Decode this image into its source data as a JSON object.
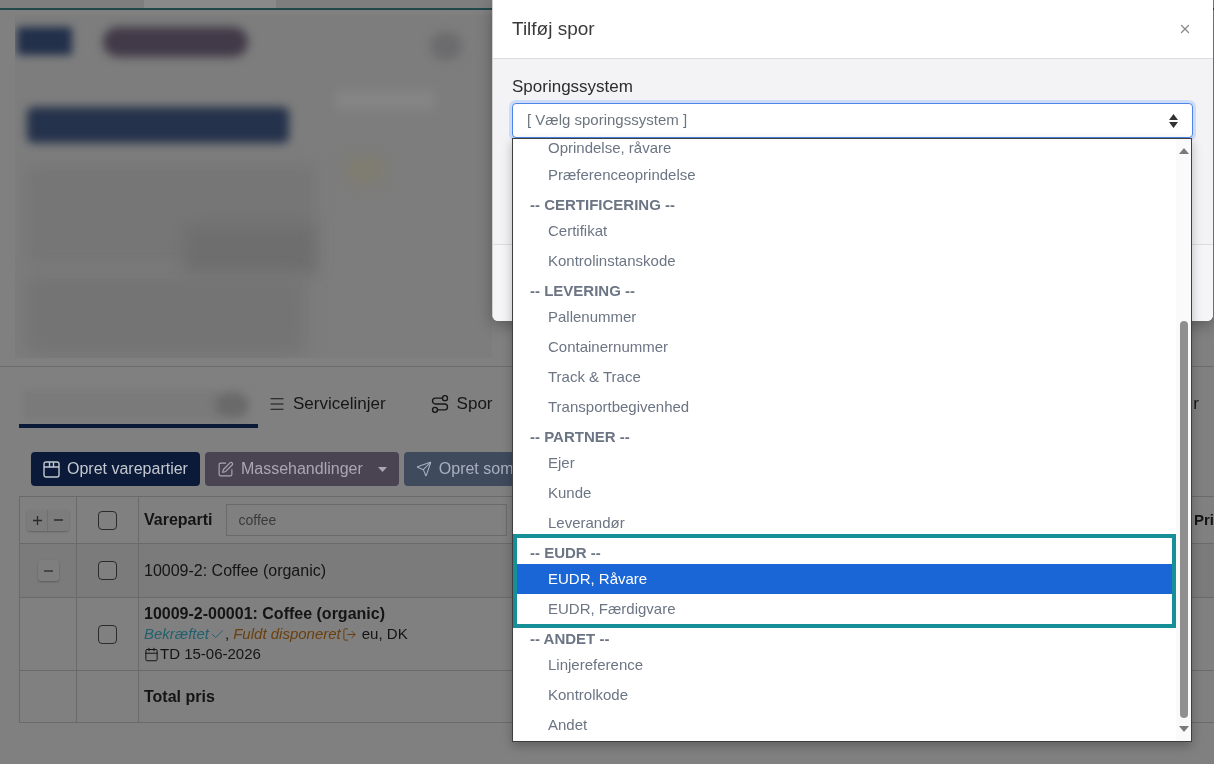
{
  "background": {
    "tabs": [
      {
        "kind": "blurred",
        "selected": true
      },
      {
        "kind": "list",
        "label": "Servicelinjer",
        "selected": false
      },
      {
        "kind": "route",
        "label": "Spor",
        "selected": false
      },
      {
        "kind": "text",
        "label": "r",
        "selected": false
      }
    ],
    "buttons": [
      {
        "kind": "primary",
        "label": "Opret varepartier"
      },
      {
        "kind": "dropdown",
        "label": "Massehandlinger"
      },
      {
        "kind": "send",
        "label": "Opret som"
      }
    ],
    "table": {
      "header": {
        "checked": false,
        "headings": [
          "Vareparti",
          "Pri"
        ],
        "filter": {
          "value": "coffee"
        }
      },
      "rows": [
        {
          "kind": "group",
          "title": "10009-2: Coffee (organic)",
          "expanded": true,
          "checked": false
        },
        {
          "kind": "lot",
          "title": "10009-2-00001: Coffee (organic)",
          "checked": false,
          "statuses": [
            {
              "kind": "confirmed",
              "label": "Bekræftet",
              "suffix": ","
            },
            {
              "kind": "disposed",
              "label": "Fuldt disponeret"
            }
          ],
          "origin": "eu, DK",
          "date": "TD 15-06-2026"
        },
        {
          "kind": "total",
          "title": "Total pris"
        }
      ]
    }
  },
  "dialog": {
    "title": "Tilføj spor",
    "field": {
      "label": "Sporingssystem",
      "placeholder": "[ Vælg sporingssystem ]"
    },
    "dropdown": {
      "groups": [
        {
          "highlighted": false,
          "options": [
            {
              "label": "Oprindelse, råvare",
              "selected": false
            },
            {
              "label": "Præferenceoprindelse",
              "selected": false
            }
          ]
        },
        {
          "label": "-- CERTIFICERING --",
          "highlighted": false,
          "options": [
            {
              "label": "Certifikat",
              "selected": false
            },
            {
              "label": "Kontrolinstanskode",
              "selected": false
            }
          ]
        },
        {
          "label": "-- LEVERING --",
          "highlighted": false,
          "options": [
            {
              "label": "Pallenummer",
              "selected": false
            },
            {
              "label": "Containernummer",
              "selected": false
            },
            {
              "label": "Track & Trace",
              "selected": false
            },
            {
              "label": "Transportbegivenhed",
              "selected": false
            }
          ]
        },
        {
          "label": "-- PARTNER --",
          "highlighted": false,
          "options": [
            {
              "label": "Ejer",
              "selected": false
            },
            {
              "label": "Kunde",
              "selected": false
            },
            {
              "label": "Leverandør",
              "selected": false
            }
          ]
        },
        {
          "label": "-- EUDR --",
          "highlighted": true,
          "options": [
            {
              "label": "EUDR, Råvare",
              "selected": true
            },
            {
              "label": "EUDR, Færdigvare",
              "selected": false
            }
          ]
        },
        {
          "label": "-- ANDET --",
          "highlighted": false,
          "options": [
            {
              "label": "Linjereference",
              "selected": false
            },
            {
              "label": "Kontrolkode",
              "selected": false
            },
            {
              "label": "Andet",
              "selected": false
            }
          ]
        }
      ]
    }
  }
}
